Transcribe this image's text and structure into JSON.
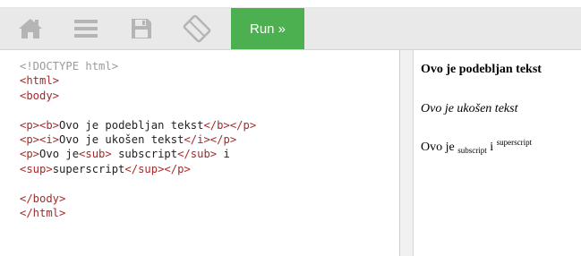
{
  "toolbar": {
    "icons": [
      "home-icon",
      "menu-icon",
      "save-icon",
      "rotate-icon"
    ],
    "run_label": "Run »",
    "run_color": "#4caf50"
  },
  "editor": {
    "lines": [
      [
        {
          "t": "doctype",
          "v": "<!DOCTYPE html>"
        }
      ],
      [
        {
          "t": "tag",
          "v": "<html>"
        }
      ],
      [
        {
          "t": "tag",
          "v": "<body>"
        }
      ],
      [],
      [
        {
          "t": "tag",
          "v": "<p><b>"
        },
        {
          "t": "txt",
          "v": "Ovo je podebljan tekst"
        },
        {
          "t": "tag",
          "v": "</b></p>"
        }
      ],
      [
        {
          "t": "tag",
          "v": "<p><i>"
        },
        {
          "t": "txt",
          "v": "Ovo je ukošen tekst"
        },
        {
          "t": "tag",
          "v": "</i></p>"
        }
      ],
      [
        {
          "t": "tag",
          "v": "<p>"
        },
        {
          "t": "txt",
          "v": "Ovo je"
        },
        {
          "t": "tag",
          "v": "<sub>"
        },
        {
          "t": "txt",
          "v": " subscript"
        },
        {
          "t": "tag",
          "v": "</sub>"
        },
        {
          "t": "txt",
          "v": " i"
        }
      ],
      [
        {
          "t": "tag",
          "v": "<sup>"
        },
        {
          "t": "txt",
          "v": "superscript"
        },
        {
          "t": "tag",
          "v": "</sup></p>"
        }
      ],
      [],
      [
        {
          "t": "tag",
          "v": "</body>"
        }
      ],
      [
        {
          "t": "tag",
          "v": "</html>"
        }
      ]
    ]
  },
  "preview": {
    "bold_text": "Ovo je podebljan tekst",
    "italic_text": "Ovo je ukošen tekst",
    "mixed_prefix": "Ovo je",
    "sub_text": "subscript",
    "mixed_mid": "i",
    "sup_text": "superscript"
  }
}
